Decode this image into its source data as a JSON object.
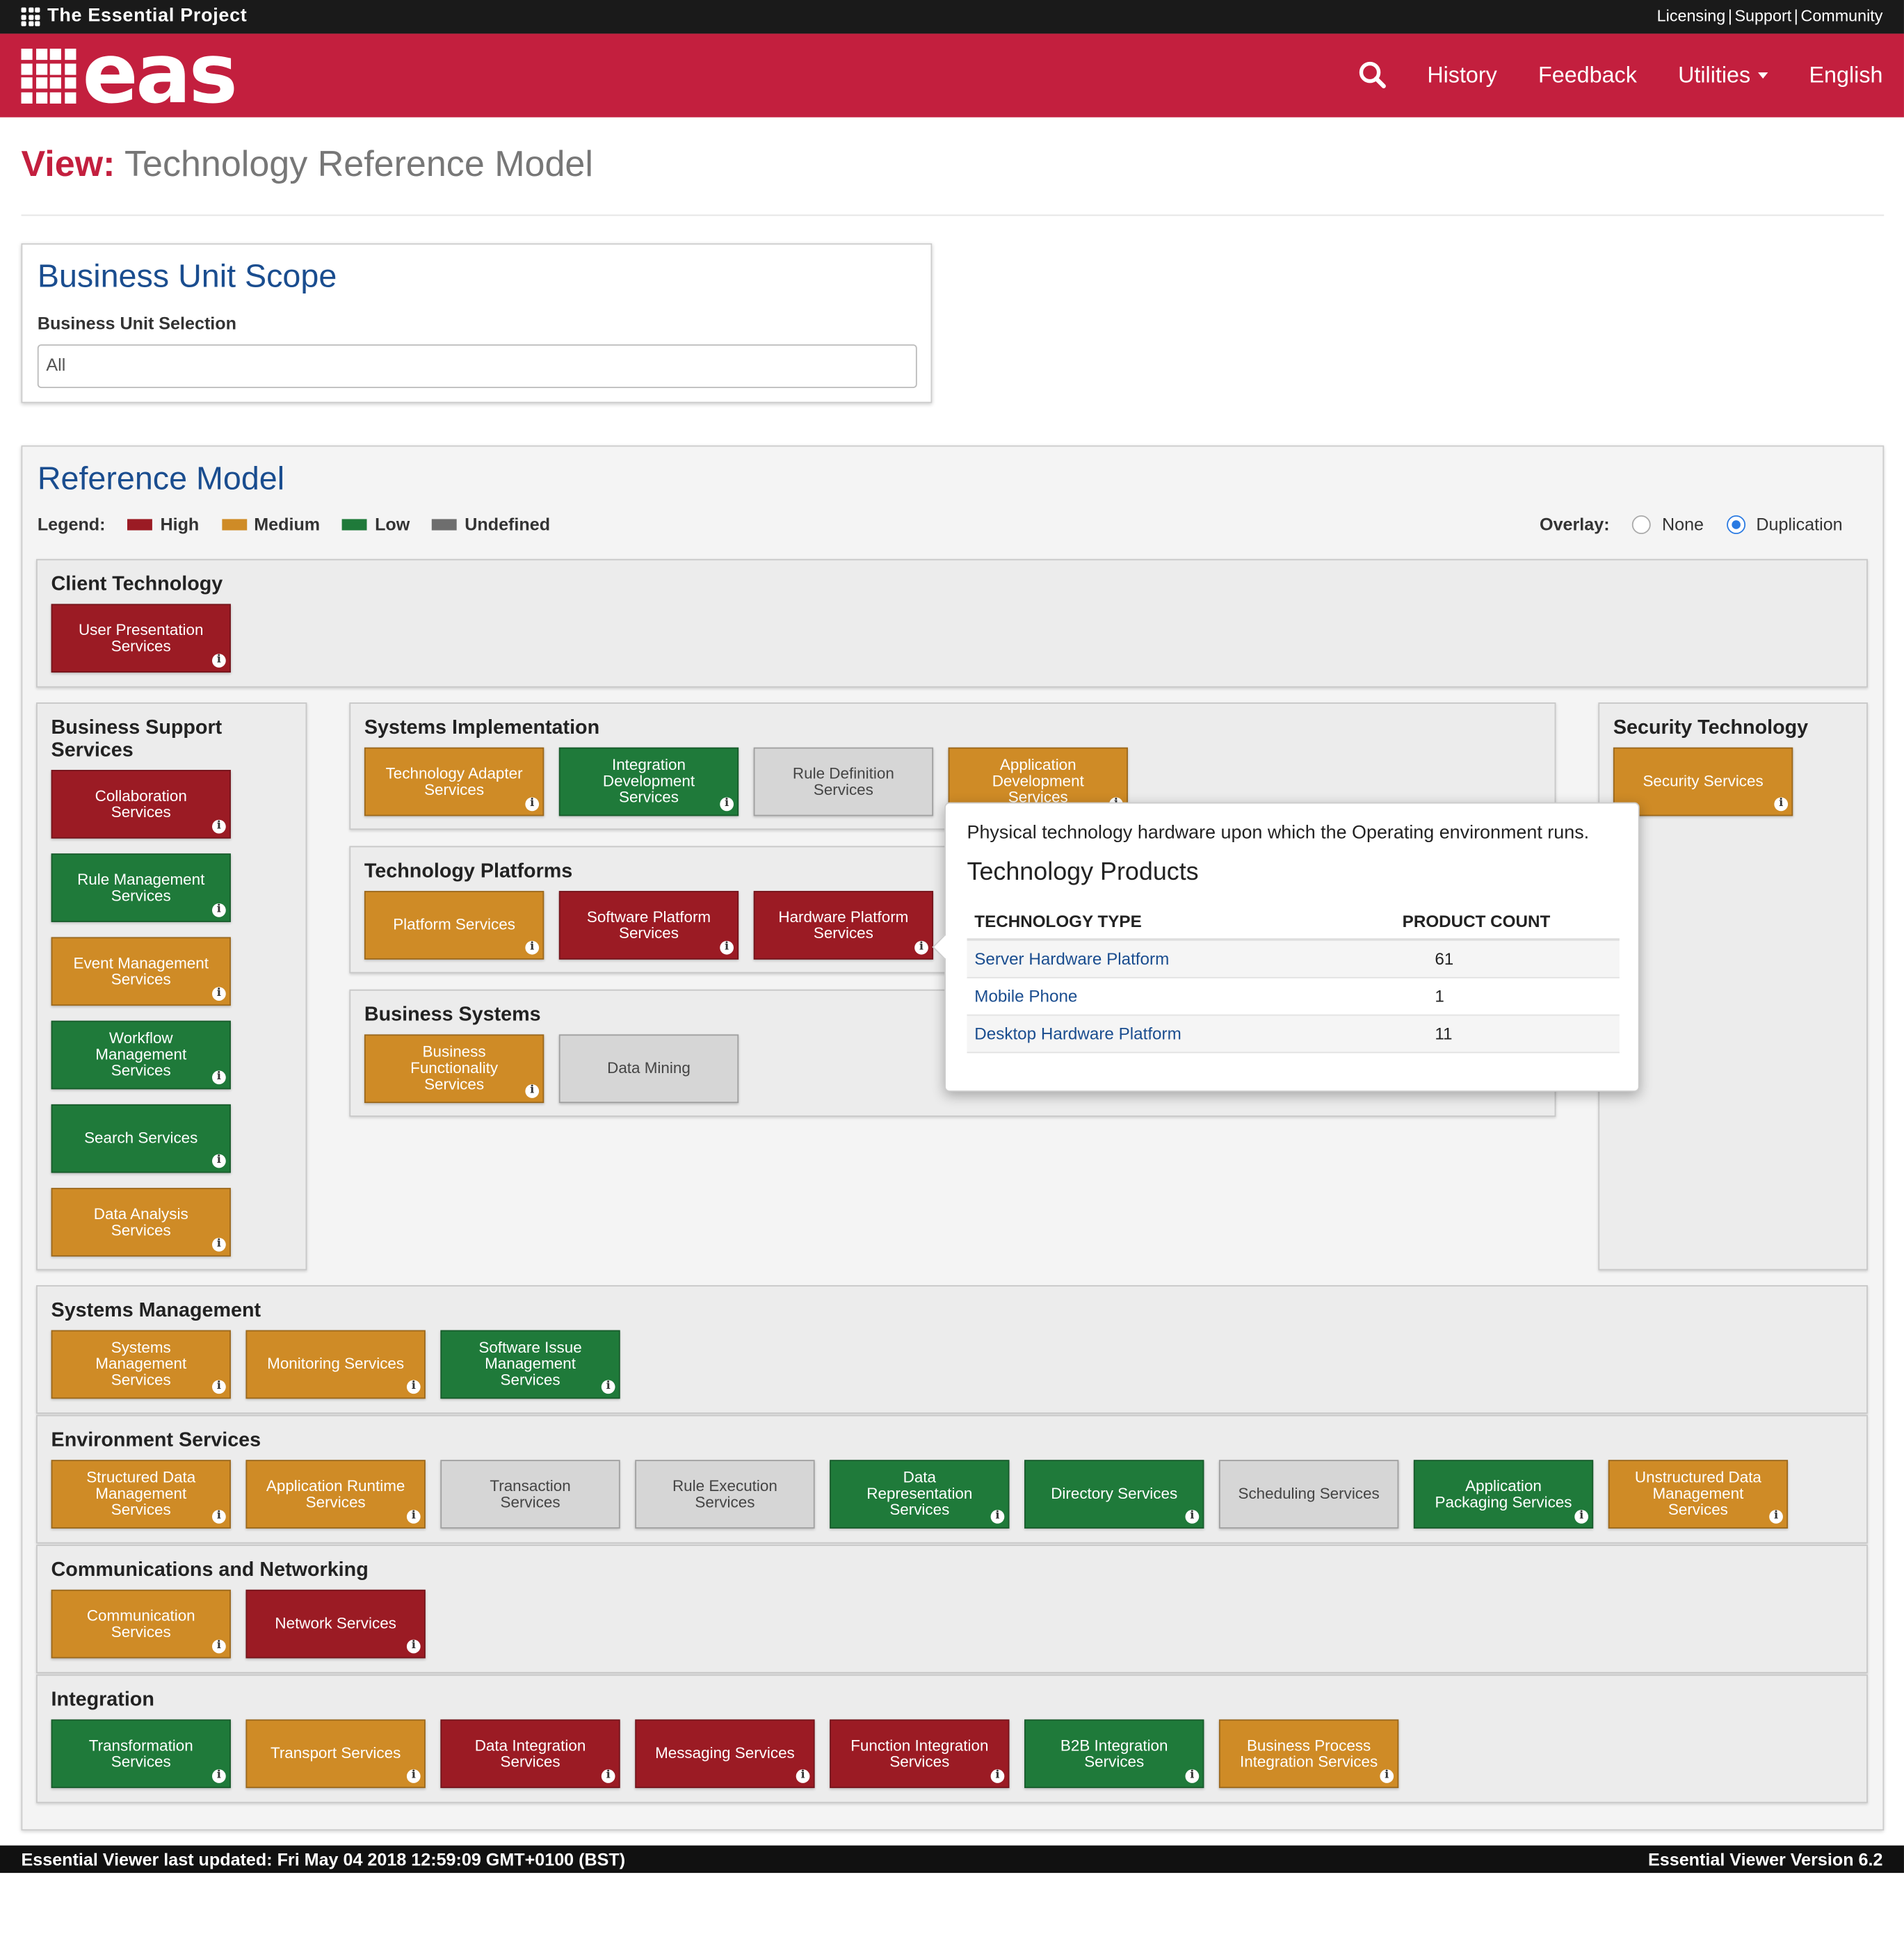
{
  "topbar": {
    "brand": "The Essential Project",
    "links": [
      "Licensing",
      "Support",
      "Community"
    ],
    "sep": "|"
  },
  "navbar": {
    "logo": "eas",
    "items": {
      "history": "History",
      "feedback": "Feedback",
      "utilities": "Utilities",
      "language": "English"
    }
  },
  "page": {
    "title_prefix": "View:",
    "title": "Technology Reference Model"
  },
  "business_unit": {
    "heading": "Business Unit Scope",
    "label": "Business Unit Selection",
    "value": "All"
  },
  "reference_model": {
    "heading": "Reference Model",
    "legend_label": "Legend:",
    "legend": [
      {
        "label": "High",
        "color": "#9b1b24"
      },
      {
        "label": "Medium",
        "color": "#cf8b26"
      },
      {
        "label": "Low",
        "color": "#1f7a3a"
      },
      {
        "label": "Undefined",
        "color": "#6e6e6e"
      }
    ],
    "overlay_label": "Overlay:",
    "overlay_options": [
      "None",
      "Duplication"
    ],
    "overlay_selected": "Duplication",
    "groups": {
      "client": {
        "title": "Client Technology",
        "tiles": [
          {
            "label": "User Presentation Services",
            "level": "high",
            "info": true
          }
        ]
      },
      "business_support": {
        "title": "Business Support Services",
        "tiles": [
          {
            "label": "Collaboration Services",
            "level": "high",
            "info": true
          },
          {
            "label": "Rule Management Services",
            "level": "low",
            "info": true
          },
          {
            "label": "Event Management Services",
            "level": "medium",
            "info": true
          },
          {
            "label": "Workflow Management Services",
            "level": "low",
            "info": true
          },
          {
            "label": "Search Services",
            "level": "low",
            "info": true
          },
          {
            "label": "Data Analysis Services",
            "level": "medium",
            "info": true
          }
        ]
      },
      "systems_impl": {
        "title": "Systems Implementation",
        "tiles": [
          {
            "label": "Technology Adapter Services",
            "level": "medium",
            "info": true
          },
          {
            "label": "Integration Development Services",
            "level": "low",
            "info": true
          },
          {
            "label": "Rule Definition Services",
            "level": "undefined",
            "info": false
          },
          {
            "label": "Application Development Services",
            "level": "medium",
            "info": true
          }
        ]
      },
      "tech_platforms": {
        "title": "Technology Platforms",
        "tiles": [
          {
            "label": "Platform Services",
            "level": "medium",
            "info": true
          },
          {
            "label": "Software Platform Services",
            "level": "high",
            "info": true
          },
          {
            "label": "Hardware Platform Services",
            "level": "high",
            "info": true
          }
        ]
      },
      "business_systems": {
        "title": "Business Systems",
        "tiles": [
          {
            "label": "Business Functionality Services",
            "level": "medium",
            "info": true
          },
          {
            "label": "Data Mining",
            "level": "undefined",
            "info": false
          }
        ]
      },
      "security": {
        "title": "Security Technology",
        "tiles": [
          {
            "label": "Security Services",
            "level": "medium",
            "info": true
          }
        ]
      },
      "systems_mgmt": {
        "title": "Systems Management",
        "tiles": [
          {
            "label": "Systems Management Services",
            "level": "medium",
            "info": true
          },
          {
            "label": "Monitoring Services",
            "level": "medium",
            "info": true
          },
          {
            "label": "Software Issue Management Services",
            "level": "low",
            "info": true
          }
        ]
      },
      "environment": {
        "title": "Environment Services",
        "tiles": [
          {
            "label": "Structured Data Management Services",
            "level": "medium",
            "info": true
          },
          {
            "label": "Application Runtime Services",
            "level": "medium",
            "info": true
          },
          {
            "label": "Transaction Services",
            "level": "undefined",
            "info": false
          },
          {
            "label": "Rule Execution Services",
            "level": "undefined",
            "info": false
          },
          {
            "label": "Data Representation Services",
            "level": "low",
            "info": true
          },
          {
            "label": "Directory Services",
            "level": "low",
            "info": true
          },
          {
            "label": "Scheduling Services",
            "level": "undefined",
            "info": false
          },
          {
            "label": "Application Packaging Services",
            "level": "low",
            "info": true
          },
          {
            "label": "Unstructured Data Management Services",
            "level": "medium",
            "info": true
          }
        ]
      },
      "comms": {
        "title": "Communications and Networking",
        "tiles": [
          {
            "label": "Communication Services",
            "level": "medium",
            "info": true
          },
          {
            "label": "Network Services",
            "level": "high",
            "info": true
          }
        ]
      },
      "integration": {
        "title": "Integration",
        "tiles": [
          {
            "label": "Transformation Services",
            "level": "low",
            "info": true
          },
          {
            "label": "Transport Services",
            "level": "medium",
            "info": true
          },
          {
            "label": "Data Integration Services",
            "level": "high",
            "info": true
          },
          {
            "label": "Messaging Services",
            "level": "high",
            "info": true
          },
          {
            "label": "Function Integration Services",
            "level": "high",
            "info": true
          },
          {
            "label": "B2B Integration Services",
            "level": "low",
            "info": true
          },
          {
            "label": "Business Process Integration Services",
            "level": "medium",
            "info": true
          }
        ]
      }
    }
  },
  "popover": {
    "description": "Physical technology hardware upon which the Operating environment runs.",
    "heading": "Technology Products",
    "columns": [
      "TECHNOLOGY TYPE",
      "PRODUCT COUNT"
    ],
    "rows": [
      {
        "type": "Server Hardware Platform",
        "count": "61"
      },
      {
        "type": "Mobile Phone",
        "count": "1"
      },
      {
        "type": "Desktop Hardware Platform",
        "count": "11"
      }
    ]
  },
  "footer": {
    "updated": "Essential Viewer last updated: Fri May 04 2018 12:59:09 GMT+0100 (BST)",
    "version": "Essential Viewer Version 6.2"
  }
}
